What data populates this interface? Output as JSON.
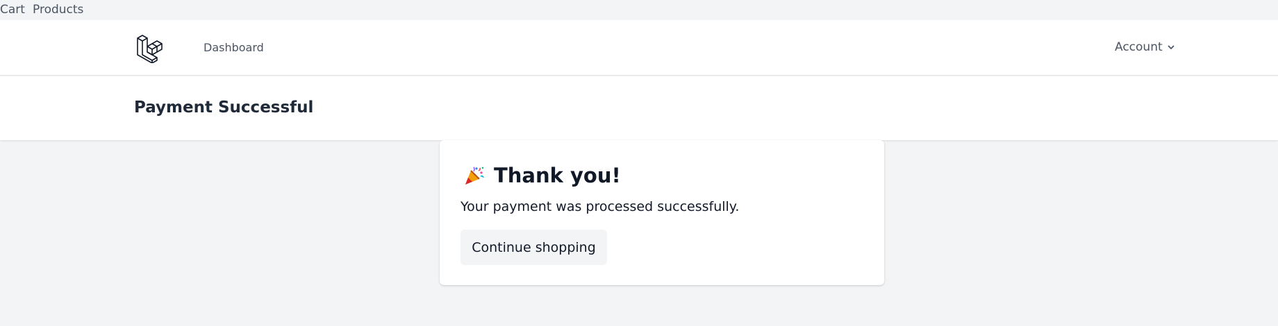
{
  "top_links": {
    "cart": "Cart",
    "products": "Products"
  },
  "nav": {
    "logo_icon": "laravel-logo-icon",
    "dashboard": "Dashboard",
    "account": "Account",
    "account_icon": "chevron-down-icon"
  },
  "header": {
    "title": "Payment Successful"
  },
  "card": {
    "icon": "party-popper-icon",
    "heading": "Thank you!",
    "message": "Your payment was processed successfully.",
    "button_label": "Continue shopping"
  }
}
